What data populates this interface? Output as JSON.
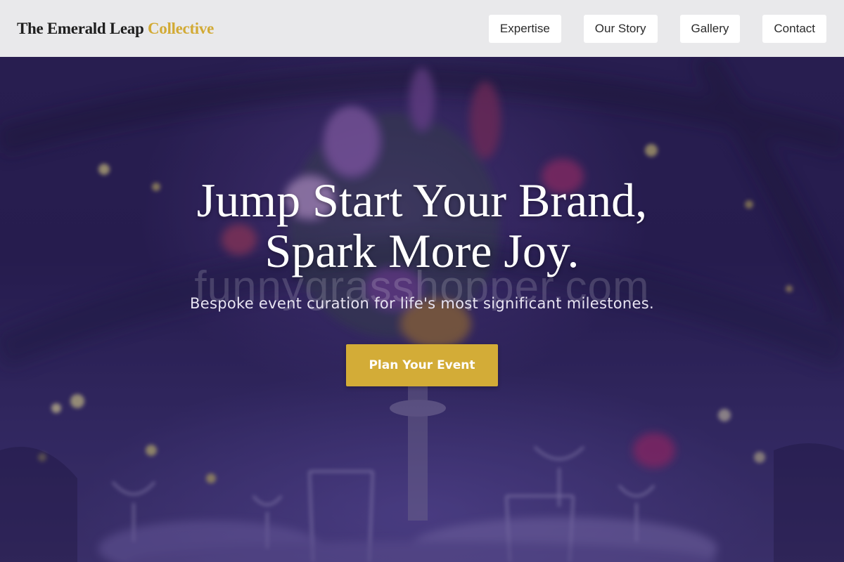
{
  "header": {
    "brand_main": "The Emerald Leap",
    "brand_accent": "Collective",
    "nav": [
      "Expertise",
      "Our Story",
      "Gallery",
      "Contact"
    ]
  },
  "hero": {
    "headline_line1": "Jump Start Your Brand,",
    "headline_line2": "Spark More Joy.",
    "watermark": "funnygrasshopper.com",
    "subline": "Bespoke event curation for life's most significant milestones.",
    "cta_label": "Plan Your Event"
  },
  "colors": {
    "header_bg": "#e9e9eb",
    "brand_accent": "#d2aa35",
    "cta_bg": "#d3ac37",
    "hero_tint": "#2d2258"
  }
}
